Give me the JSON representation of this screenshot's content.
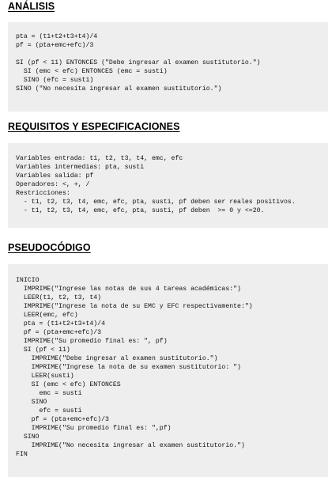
{
  "sections": [
    {
      "title": "ANÁLISIS",
      "lines": [
        "pta = (t1+t2+t3+t4)/4",
        "pf = (pta+emc+efc)/3",
        "",
        "SI (pf < 11) ENTONCES (\"Debe ingresar al examen sustitutorio.\")",
        "  SI (emc < efc) ENTONCES (emc = susti)",
        "  SINO (efc = susti)",
        "SINO (\"No necesita ingresar al examen sustitutorio.\")"
      ]
    },
    {
      "title": "REQUISITOS Y ESPECIFICACIONES",
      "lines": [
        "Variables entrada: t1, t2, t3, t4, emc, efc",
        "Variables intermedias: pta, susti",
        "Variables salida: pf",
        "Operadores: <, +, /",
        "Restricciones:",
        "  - t1, t2, t3, t4, emc, efc, pta, susti, pf deben ser reales positivos.",
        "  - t1, t2, t3, t4, emc, efc, pta, susti, pf deben  >= 0 y <=20."
      ]
    },
    {
      "title": "PSEUDOCÓDIGO",
      "lines": [
        "INICIO",
        "  IMPRIME(\"Ingrese las notas de sus 4 tareas académicas:\")",
        "  LEER(t1, t2, t3, t4)",
        "  IMPRIME(\"Ingrese la nota de su EMC y EFC respectivamente:\")",
        "  LEER(emc, efc)",
        "  pta = (t1+t2+t3+t4)/4",
        "  pf = (pta+emc+efc)/3",
        "  IMPRIME(\"Su promedio final es: \", pf)",
        "  SI (pf < 11)",
        "    IMPRIME(\"Debe ingresar al examen sustitutorio.\")",
        "    IMPRIME(\"Ingrese la nota de su examen sustitutorio: \")",
        "    LEER(susti)",
        "    SI (emc < efc) ENTONCES",
        "      emc = susti",
        "    SINO",
        "      efc = susti",
        "    pf = (pta+emc+efc)/3",
        "    IMPRIME(\"Su promedio final es: \",pf)",
        "  SINO",
        "    IMPRIME(\"No necesita ingresar al examen sustitutorio.\")",
        "FIN"
      ]
    }
  ]
}
